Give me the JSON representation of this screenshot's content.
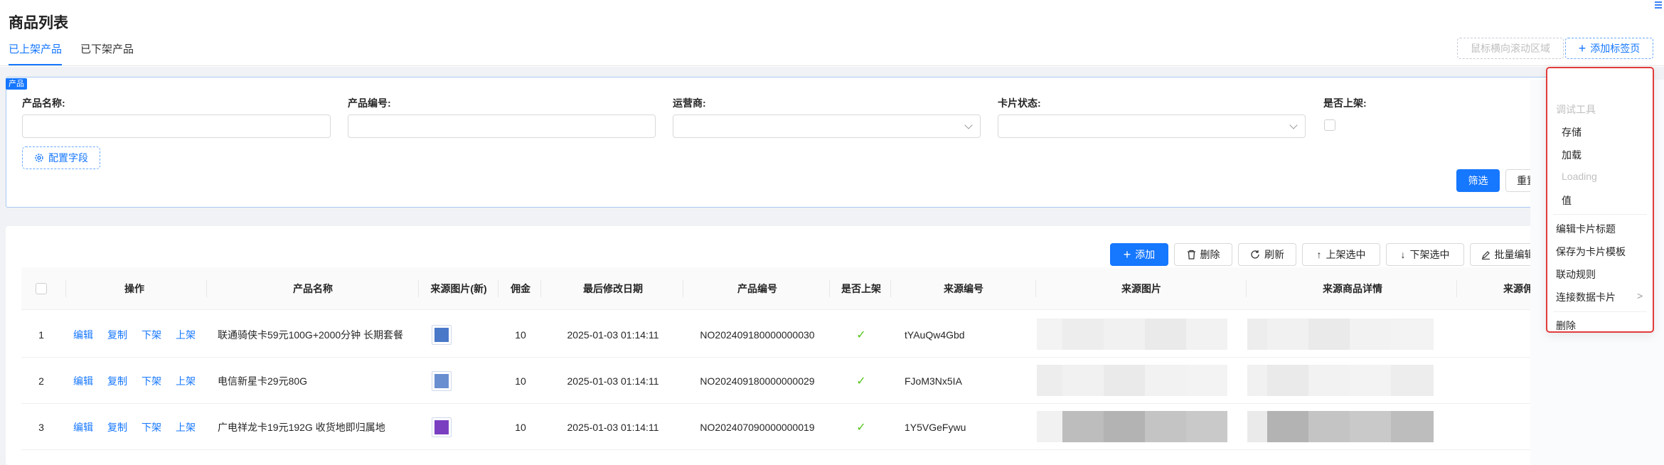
{
  "page_title": "商品列表",
  "tabs": [
    {
      "label": "已上架产品",
      "active": true
    },
    {
      "label": "已下架产品",
      "active": false
    }
  ],
  "top_actions": {
    "scroll_area_label": "鼠标横向滚动区域",
    "add_tab_label": "添加标签页"
  },
  "filter_card": {
    "tag": "产品",
    "fields": [
      {
        "label": "产品名称:",
        "type": "text",
        "value": ""
      },
      {
        "label": "产品编号:",
        "type": "text",
        "value": ""
      },
      {
        "label": "运营商:",
        "type": "select",
        "value": ""
      },
      {
        "label": "卡片状态:",
        "type": "select",
        "value": ""
      },
      {
        "label": "是否上架:",
        "type": "checkbox",
        "checked": false
      }
    ],
    "config_label": "配置字段",
    "filter_label": "筛选",
    "reset_label": "重置"
  },
  "toolbar": {
    "add": "添加",
    "delete": "删除",
    "refresh": "刷新",
    "list_selected": "上架选中",
    "delist_selected": "下架选中",
    "batch_edit": "批量编辑"
  },
  "table": {
    "columns": [
      "操作",
      "产品名称",
      "来源图片(新)",
      "佣金",
      "最后修改日期",
      "产品编号",
      "是否上架",
      "来源编号",
      "来源图片",
      "来源商品详情",
      "来源佣"
    ],
    "actions": [
      "编辑",
      "复制",
      "下架",
      "上架"
    ],
    "rows": [
      {
        "index": "1",
        "name": "联通骑侠卡59元100G+2000分钟 长期套餐",
        "commission": "10",
        "modified": "2025-01-03 01:14:11",
        "code": "NO202409180000000030",
        "listed": true,
        "source_code": "tYAuQw4Gbd",
        "thumb_color": "#4a78c8"
      },
      {
        "index": "2",
        "name": "电信新星卡29元80G",
        "commission": "10",
        "modified": "2025-01-03 01:14:11",
        "code": "NO202409180000000029",
        "listed": true,
        "source_code": "FJoM3Nx5IA",
        "thumb_color": "#6a8fd0"
      },
      {
        "index": "3",
        "name": "广电祥龙卡19元192G 收货地即归属地",
        "commission": "10",
        "modified": "2025-01-03 01:14:11",
        "code": "NO202407090000000019",
        "listed": true,
        "source_code": "1Y5VGeFywu",
        "thumb_color": "#7a3fc0"
      }
    ]
  },
  "context_menu": {
    "header": "调试工具",
    "items": [
      {
        "label": "存储",
        "disabled": false
      },
      {
        "label": "加载",
        "disabled": false
      },
      {
        "label": "Loading",
        "disabled": true
      },
      {
        "label": "值",
        "disabled": false
      }
    ],
    "items2": [
      {
        "label": "编辑卡片标题"
      },
      {
        "label": "保存为卡片模板"
      },
      {
        "label": "联动规则"
      },
      {
        "label": "连接数据卡片"
      }
    ],
    "delete": "删除"
  }
}
